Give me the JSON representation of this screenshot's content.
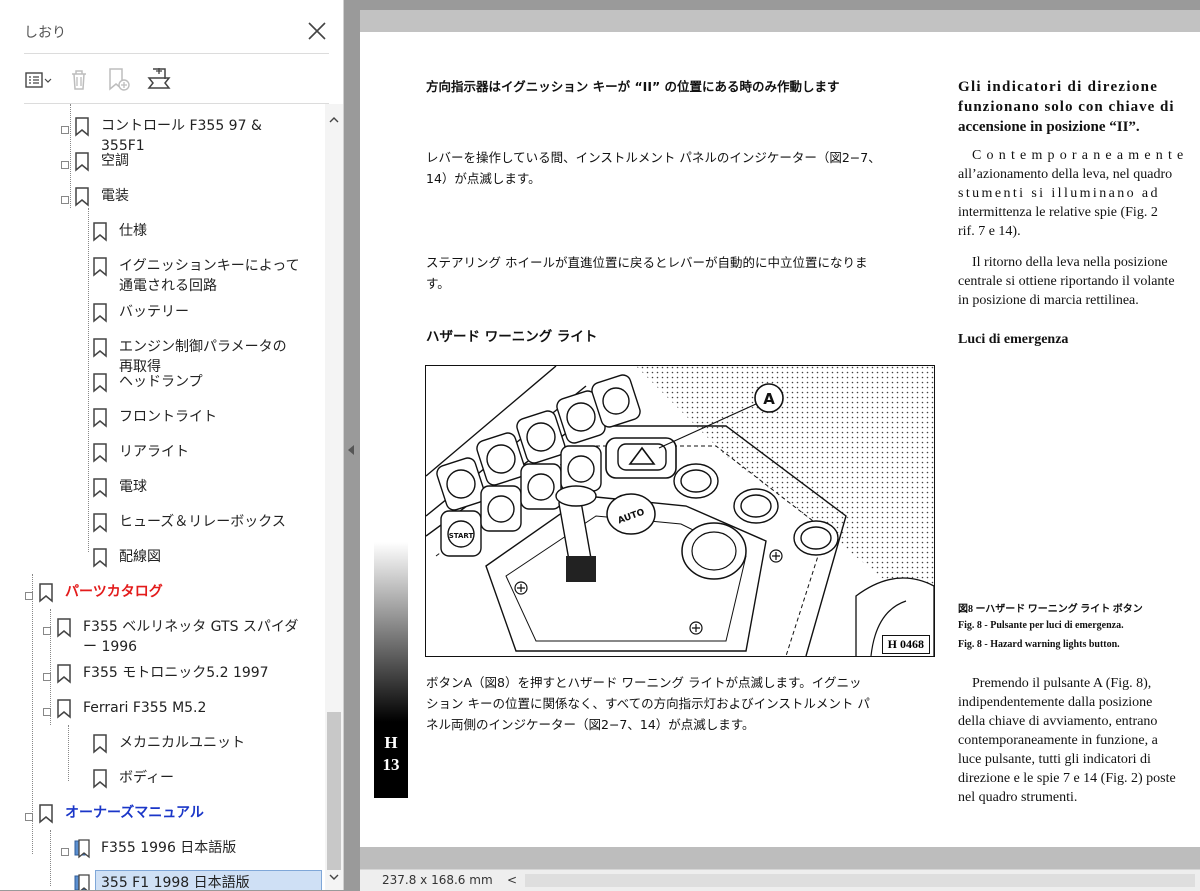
{
  "sidebar": {
    "title": "しおり",
    "close_icon": "close-icon",
    "tools": [
      "options-menu-icon",
      "delete-icon",
      "new-bookmark-icon",
      "find-bookmark-icon"
    ],
    "items": [
      {
        "label": "コントロール F355 97 & 355F1",
        "level": 1,
        "expandable": true
      },
      {
        "label": "空調",
        "level": 1,
        "expandable": true
      },
      {
        "label": "電装",
        "level": 1,
        "expandable": true
      },
      {
        "label": "仕様",
        "level": 2
      },
      {
        "label": "イグニッションキーによって通電される回路",
        "level": 2
      },
      {
        "label": "バッテリー",
        "level": 2
      },
      {
        "label": "エンジン制御パラメータの再取得",
        "level": 2
      },
      {
        "label": "ヘッドランプ",
        "level": 2
      },
      {
        "label": "フロントライト",
        "level": 2
      },
      {
        "label": "リアライト",
        "level": 2
      },
      {
        "label": "電球",
        "level": 2
      },
      {
        "label": "ヒューズ＆リレーボックス",
        "level": 2
      },
      {
        "label": "配線図",
        "level": 2
      },
      {
        "label": "パーツカタログ",
        "level": 0,
        "color": "#e31b1b"
      },
      {
        "label": "F355 ベルリネッタ GTS スパイダー 1996",
        "level": 1
      },
      {
        "label": "F355 モトロニック5.2 1997",
        "level": 1
      },
      {
        "label": "Ferrari F355 M5.2",
        "level": 1
      },
      {
        "label": "メカニカルユニット",
        "level": 2
      },
      {
        "label": "ボディー",
        "level": 2
      },
      {
        "label": "オーナーズマニュアル",
        "level": 0,
        "color": "#1a36c8"
      },
      {
        "label": "F355 1996 日本語版",
        "level": 1
      },
      {
        "label": "355 F1 1998 日本語版",
        "level": 1,
        "selected": true
      }
    ]
  },
  "page": {
    "jp": {
      "p1": "方向指示器はイグニッション キーが “II” の位置にある時のみ作動します",
      "p2a": "レバーを操作している間、インストルメント パネルのインジケーター（図2−7、",
      "p2b": "14）が点滅します。",
      "p3a": "ステアリング ホイールが直進位置に戻るとレバーが自動的に中立位置になりま",
      "p3b": "す。",
      "heading": "ハザード ワーニング ライト",
      "p4a": "ボタンA（図8）を押すとハザード ワーニング ライトが点滅します。イグニッ",
      "p4b": "ション キーの位置に関係なく、すべての方向指示灯およびインストルメント パ",
      "p4c": "ネル両側のインジケーター（図2−7、14）が点滅します。"
    },
    "it": {
      "p1a": "Gli indicatori di direzione",
      "p1b": "funzionano solo con chiave di",
      "p1c": "accensione in posizione “II”.",
      "p2a": "Contemporaneamente",
      "p2b": "all’azionamento della leva, nel quadro",
      "p2c": "stumenti si illuminano ad",
      "p2d": "intermittenza le relative spie (Fig. 2",
      "p2e": "rif. 7 e 14).",
      "p3a": "Il ritorno della leva nella posizione",
      "p3b": "centrale si ottiene riportando il volante",
      "p3c": "in posizione di marcia rettilinea.",
      "heading": "Luci di emergenza",
      "p4a": "Premendo il pulsante A (Fig. 8),",
      "p4b": "indipendentemente dalla posizione",
      "p4c": "della chiave di avviamento, entrano",
      "p4d": "contemporaneamente in funzione, a",
      "p4e": "luce pulsante, tutti gli indicatori di",
      "p4f": "direzione e le spie 7 e 14 (Fig. 2) poste",
      "p4g": "nel quadro strumenti."
    },
    "captions": {
      "jp": "図8 ーハザード ワーニング ライト ボタン",
      "it": "Fig. 8 - Pulsante per luci di emergenza.",
      "en": "Fig. 8 - Hazard warning lights button."
    },
    "figure": {
      "callout": "A",
      "code": "H 0468",
      "buttons": [
        "START",
        "AUTO"
      ]
    },
    "section_tab": {
      "letter": "H",
      "number": "13"
    }
  },
  "statusbar": {
    "size": "237.8 x 168.6 mm",
    "scroll_left": "<"
  }
}
